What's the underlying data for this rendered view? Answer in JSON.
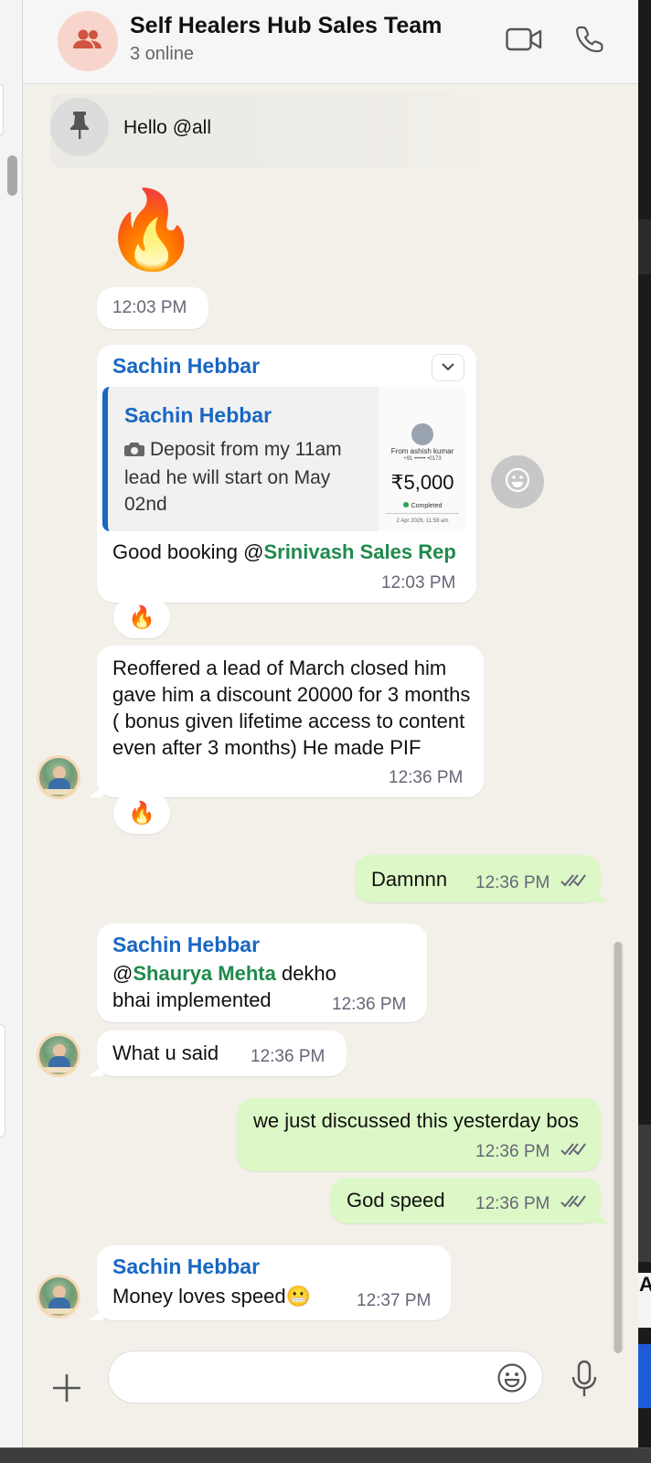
{
  "header": {
    "title": "Self Healers Hub Sales Team",
    "subtitle": "3 online"
  },
  "pinned": {
    "text": "Hello @all"
  },
  "messages": {
    "fire_emoji": {
      "emoji": "🔥",
      "time": "12:03 PM"
    },
    "reply_msg": {
      "sender": "Sachin Hebbar",
      "quote_sender": "Sachin Hebbar",
      "quote_text": "Deposit from my 11am lead he will start on May 02nd",
      "thumb_from": "From ashish kumar",
      "thumb_phone": "+91 •••••• •0173",
      "thumb_amount": "₹5,000",
      "thumb_status": "Completed",
      "thumb_date": "2 Apr 2026, 11:59 am",
      "text_prefix": "Good booking @",
      "mention": "Srinivash Sales Rep",
      "time": "12:03 PM",
      "reaction": "🔥"
    },
    "reoffered_msg": {
      "text": "Reoffered a lead of March closed him gave him a discount 20000 for 3 months ( bonus given lifetime access to content even after 3 months) He made PIF",
      "time": "12:36 PM",
      "reaction": "🔥"
    },
    "damnnn_msg": {
      "text": "Damnnn",
      "time": "12:36 PM"
    },
    "implemented_msg": {
      "sender": "Sachin Hebbar",
      "mention_prefix": "@",
      "mention": "Shaurya Mehta",
      "text_after": " dekho bhai implemented",
      "time": "12:36 PM"
    },
    "what_u_said_msg": {
      "text": "What u said",
      "time": "12:36 PM"
    },
    "discussed_msg": {
      "text": "we just discussed this yesterday bos",
      "time": "12:36 PM"
    },
    "god_speed_msg": {
      "text": "God speed",
      "time": "12:36 PM"
    },
    "money_msg": {
      "sender": "Sachin Hebbar",
      "text": "Money loves speed😬",
      "time": "12:37 PM"
    }
  },
  "composer": {
    "value": ""
  },
  "external": {
    "right_edge_letter": "A"
  },
  "colors": {
    "sender": "#1967c2",
    "mention": "#1f8a4c",
    "outgoing_bubble": "#dcf8c6",
    "incoming_bubble": "#ffffff",
    "chat_background": "#f3f0ea",
    "read_ticks": "#667"
  },
  "icons": {
    "group_avatar": "people-icon",
    "video": "video-camera-icon",
    "call": "phone-icon",
    "pin": "pin-icon",
    "camera": "camera-icon",
    "dropdown": "chevron-down-icon",
    "react": "smiley-icon",
    "read": "double-check-icon",
    "plus": "plus-icon",
    "emoji": "emoji-icon",
    "mic": "microphone-icon"
  }
}
